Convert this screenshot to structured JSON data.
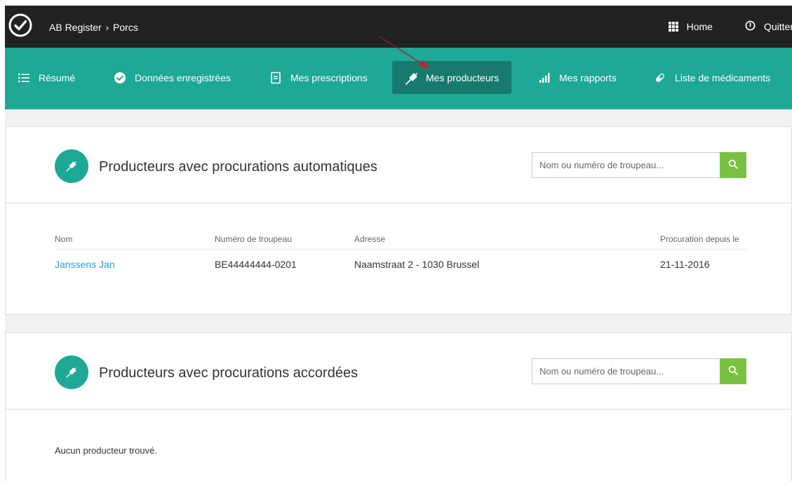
{
  "topbar": {
    "breadcrumb": [
      "AB Register",
      "Porcs"
    ],
    "home_label": "Home",
    "quit_label": "Quitter"
  },
  "nav": {
    "items": [
      {
        "label": "Résumé",
        "icon": "list-icon"
      },
      {
        "label": "Données enregistrées",
        "icon": "check-circle-icon"
      },
      {
        "label": "Mes prescriptions",
        "icon": "document-icon"
      },
      {
        "label": "Mes producteurs",
        "icon": "wheat-icon",
        "active": true
      },
      {
        "label": "Mes rapports",
        "icon": "bar-chart-icon"
      },
      {
        "label": "Liste de médicaments",
        "icon": "pill-icon"
      }
    ],
    "active_color": "#187a6f",
    "bar_color": "#1ea896"
  },
  "panel_auto": {
    "title": "Producteurs avec procurations automatiques",
    "search_placeholder": "Nom ou numéro de troupeau...",
    "columns": [
      "Nom",
      "Numéro de troupeau",
      "Adresse",
      "Procuration depuis le"
    ],
    "rows": [
      [
        "Janssens Jan",
        "BE44444444-0201",
        "Naamstraat 2 - 1030 Brussel",
        "21-11-2016"
      ]
    ]
  },
  "panel_granted": {
    "title": "Producteurs avec procurations accordées",
    "search_placeholder": "Nom ou numéro de troupeau...",
    "empty_message": "Aucun producteur trouvé."
  }
}
